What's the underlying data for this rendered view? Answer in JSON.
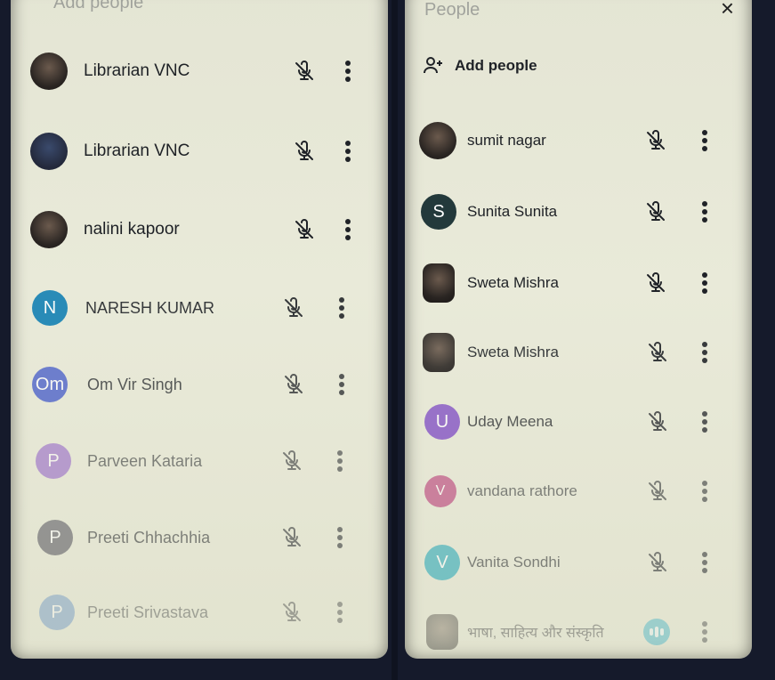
{
  "left_panel": {
    "header_text": "Add people",
    "participants": [
      {
        "name": "Librarian VNC",
        "initial": "",
        "avatar_color": "#3a4049"
      },
      {
        "name": "Librarian VNC",
        "initial": "",
        "avatar_color": "#2c3141"
      },
      {
        "name": "nalini kapoor",
        "initial": "",
        "avatar_color": "#3d332e"
      },
      {
        "name": "NARESH KUMAR",
        "initial": "N",
        "avatar_color": "#0f7fb3"
      },
      {
        "name": "Om Vir Singh",
        "initial": "Om",
        "avatar_color": "#3f56c9"
      },
      {
        "name": "Parveen Kataria",
        "initial": "P",
        "avatar_color": "#8c57c6"
      },
      {
        "name": "Preeti Chhachhia",
        "initial": "P",
        "avatar_color": "#4c4c57"
      },
      {
        "name": "Preeti Srivastava",
        "initial": "P",
        "avatar_color": "#4a7fbf"
      }
    ]
  },
  "right_panel": {
    "header_text": "People",
    "add_people_label": "Add people",
    "participants": [
      {
        "name": "sumit nagar",
        "initial": "",
        "avatar_color": "#4a4038"
      },
      {
        "name": "Sunita Sunita",
        "initial": "S",
        "avatar_color": "#23393b"
      },
      {
        "name": "Sweta Mishra",
        "initial": "",
        "avatar_color": "#5c4c3e"
      },
      {
        "name": "Sweta Mishra",
        "initial": "",
        "avatar_color": "#5c4c3e"
      },
      {
        "name": "Uday Meena",
        "initial": "U",
        "avatar_color": "#7b45c4"
      },
      {
        "name": "vandana rathore",
        "initial": "V",
        "avatar_color": "#b2246a"
      },
      {
        "name": "Vanita Sondhi",
        "initial": "V",
        "avatar_color": "#14a2b5"
      },
      {
        "name": "भाषा, साहित्य और संस्कृति",
        "initial": "",
        "avatar_color": "#6b564a"
      }
    ]
  },
  "colors": {
    "panel_bg": "#e6e7d6",
    "text": "#1e2126",
    "icon": "#2a2d33",
    "speaking": "#1aa6c4"
  },
  "icons": {
    "mic_muted": "mic-off-icon",
    "more": "more-vert-icon",
    "add_people": "person-add-icon",
    "close": "close-icon",
    "speaking": "speaking-indicator-icon"
  }
}
